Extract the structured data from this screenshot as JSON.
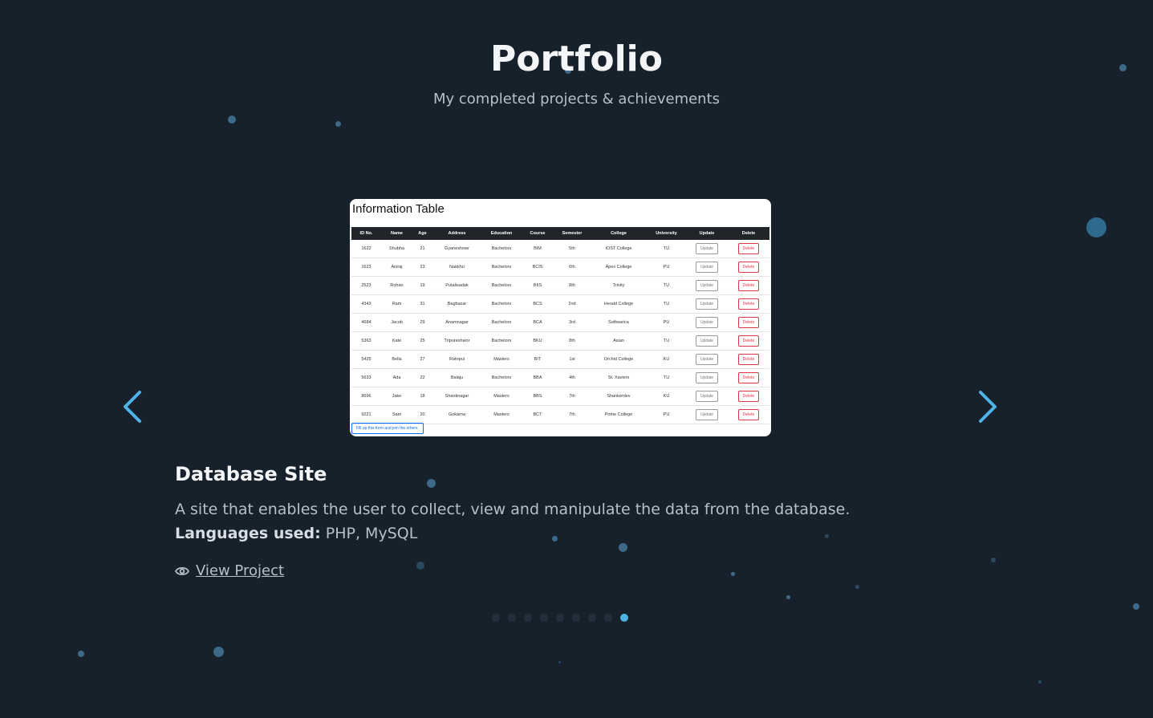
{
  "header": {
    "title": "Portfolio",
    "subtitle": "My completed projects & achievements"
  },
  "carousel": {
    "prev_icon": "chevron-left-icon",
    "next_icon": "chevron-right-icon",
    "accent_color": "#4fb3e6",
    "slide_count": 9,
    "active_index": 8
  },
  "screenshot": {
    "heading": "Information Table",
    "columns": [
      "ID No.",
      "Name",
      "Age",
      "Address",
      "Education",
      "Course",
      "Semester",
      "College",
      "University",
      "Update",
      "Delete"
    ],
    "rows": [
      [
        "1622",
        "Shubha",
        "21",
        "Gyaneshowr",
        "Bachelors",
        "BIM",
        "5th",
        "IOST College",
        "TU"
      ],
      [
        "1623",
        "Aniraj",
        "23",
        "Nakkhu",
        "Bachelors",
        "BCIS",
        "6th",
        "Apex College",
        "PU"
      ],
      [
        "2523",
        "Rohan",
        "19",
        "Putalisadak",
        "Bachelors",
        "BIIS",
        "8th",
        "Trinity",
        "TU"
      ],
      [
        "4343",
        "Ram",
        "31",
        "Bagbazar",
        "Bachelors",
        "BCS",
        "2nd",
        "Herald College",
        "TU"
      ],
      [
        "4684",
        "Jacob",
        "29",
        "Anamnagar",
        "Bachelors",
        "BCA",
        "3rd",
        "Softwarica",
        "PU"
      ],
      [
        "5363",
        "Kate",
        "25",
        "Tripureshwor",
        "Bachelors",
        "BKU",
        "8th",
        "Asian",
        "TU"
      ],
      [
        "5425",
        "Bella",
        "27",
        "Ratopul",
        "Masters",
        "BIT",
        "1st",
        "Orchid College",
        "KU"
      ],
      [
        "5633",
        "Ada",
        "22",
        "Balaju",
        "Bachelors",
        "BBA",
        "4th",
        "St. Xaviers",
        "TU"
      ],
      [
        "8696",
        "Jake",
        "18",
        "Shantinagar",
        "Masters",
        "BBS",
        "7th",
        "Shankerdev",
        "KU"
      ],
      [
        "9221",
        "Sam",
        "20",
        "Gokarna",
        "Masters",
        "BCT",
        "7th",
        "Prime College",
        "PU"
      ]
    ],
    "update_label": "Update",
    "delete_label": "Delete",
    "form_link": "Fill up this form and join the others."
  },
  "project": {
    "title": "Database Site",
    "description": "A site that enables the user to collect, view and manipulate the data from the database.",
    "languages_label": "Languages used:",
    "languages_value": " PHP, MySQL",
    "view_label": "View Project",
    "view_icon": "eye-icon"
  }
}
